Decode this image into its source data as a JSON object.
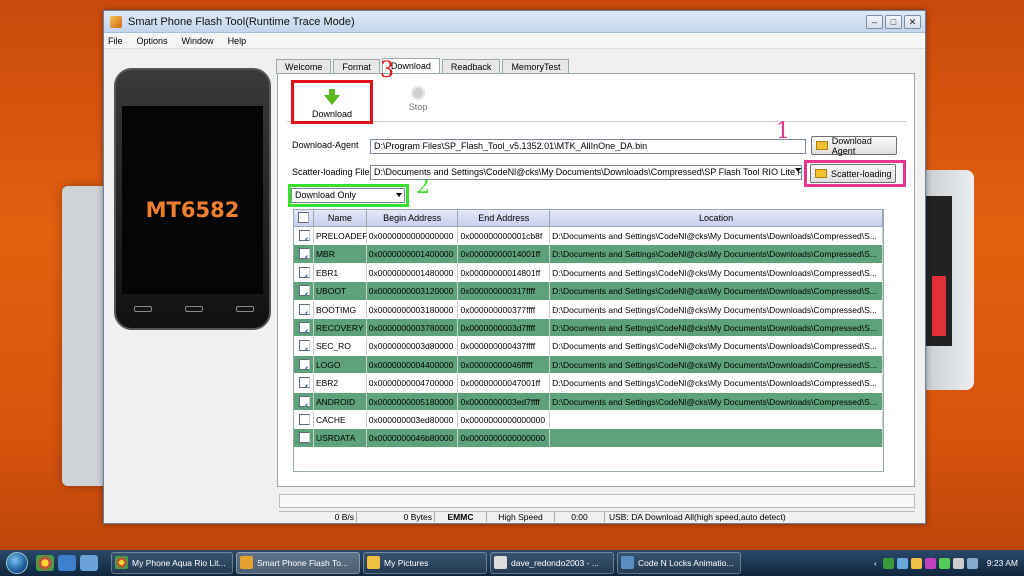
{
  "window": {
    "title": "Smart Phone Flash Tool(Runtime Trace Mode)",
    "menu": [
      "File",
      "Options",
      "Window",
      "Help"
    ]
  },
  "phone": {
    "label": "MT6582"
  },
  "tabs": [
    "Welcome",
    "Format",
    "Download",
    "Readback",
    "MemoryTest"
  ],
  "toolbar": {
    "download_label": "Download",
    "stop_label": "Stop"
  },
  "annotations": {
    "n1": "1",
    "n2": "2",
    "n3": "3"
  },
  "form": {
    "agent_label": "Download-Agent",
    "agent_value": "D:\\Program Files\\SP_Flash_Tool_v5.1352.01\\MTK_AllInOne_DA.bin",
    "agent_button": "Download Agent",
    "scatter_label": "Scatter-loading File",
    "scatter_value": "D:\\Documents and Settings\\CodeNl@cks\\My Documents\\Downloads\\Compressed\\SP Flash Tool RIO Lite Firmw",
    "scatter_button": "Scatter-loading",
    "mode_value": "Download Only"
  },
  "table": {
    "headers": [
      "",
      "Name",
      "Begin Address",
      "End Address",
      "Location"
    ],
    "rows": [
      {
        "checked": true,
        "name": "PRELOADER",
        "begin": "0x0000000000000000",
        "end": "0x000000000001cb8f",
        "location": "D:\\Documents and Settings\\CodeNl@cks\\My Documents\\Downloads\\Compressed\\S..."
      },
      {
        "checked": true,
        "name": "MBR",
        "begin": "0x0000000001400000",
        "end": "0x00000000014001ff",
        "location": "D:\\Documents and Settings\\CodeNl@cks\\My Documents\\Downloads\\Compressed\\S..."
      },
      {
        "checked": true,
        "name": "EBR1",
        "begin": "0x0000000001480000",
        "end": "0x00000000014801ff",
        "location": "D:\\Documents and Settings\\CodeNl@cks\\My Documents\\Downloads\\Compressed\\S..."
      },
      {
        "checked": true,
        "name": "UBOOT",
        "begin": "0x0000000003120000",
        "end": "0x000000000317ffff",
        "location": "D:\\Documents and Settings\\CodeNl@cks\\My Documents\\Downloads\\Compressed\\S..."
      },
      {
        "checked": true,
        "name": "BOOTIMG",
        "begin": "0x0000000003180000",
        "end": "0x000000000377ffff",
        "location": "D:\\Documents and Settings\\CodeNl@cks\\My Documents\\Downloads\\Compressed\\S..."
      },
      {
        "checked": true,
        "name": "RECOVERY",
        "begin": "0x0000000003780000",
        "end": "0x0000000003d7ffff",
        "location": "D:\\Documents and Settings\\CodeNl@cks\\My Documents\\Downloads\\Compressed\\S..."
      },
      {
        "checked": true,
        "name": "SEC_RO",
        "begin": "0x0000000003d80000",
        "end": "0x000000000437ffff",
        "location": "D:\\Documents and Settings\\CodeNl@cks\\My Documents\\Downloads\\Compressed\\S..."
      },
      {
        "checked": true,
        "name": "LOGO",
        "begin": "0x0000000004400000",
        "end": "0x00000000046fffff",
        "location": "D:\\Documents and Settings\\CodeNl@cks\\My Documents\\Downloads\\Compressed\\S..."
      },
      {
        "checked": true,
        "name": "EBR2",
        "begin": "0x0000000004700000",
        "end": "0x00000000047001ff",
        "location": "D:\\Documents and Settings\\CodeNl@cks\\My Documents\\Downloads\\Compressed\\S..."
      },
      {
        "checked": true,
        "name": "ANDROID",
        "begin": "0x0000000005180000",
        "end": "0x0000000003ed7ffff",
        "location": "D:\\Documents and Settings\\CodeNl@cks\\My Documents\\Downloads\\Compressed\\S..."
      },
      {
        "checked": false,
        "name": "CACHE",
        "begin": "0x000000003ed80000",
        "end": "0x0000000000000000",
        "location": ""
      },
      {
        "checked": false,
        "name": "USRDATA",
        "begin": "0x0000000046b80000",
        "end": "0x0000000000000000",
        "location": ""
      }
    ]
  },
  "status": {
    "speed": "0 B/s",
    "bytes": "0 Bytes",
    "storage": "EMMC",
    "usb_speed": "High Speed",
    "time": "0:00",
    "message": "USB: DA Download All(high speed,auto detect)"
  },
  "taskbar": {
    "tasks": [
      {
        "label": "My Phone Aqua Rio Lit...",
        "active": false
      },
      {
        "label": "Smart Phone Flash To...",
        "active": true
      },
      {
        "label": "My Pictures",
        "active": false
      },
      {
        "label": "dave_redondo2003 - ...",
        "active": false
      },
      {
        "label": "Code N Locks Animatio...",
        "active": false
      }
    ],
    "clock": "9:23 AM"
  },
  "colors": {
    "row_highlight": "#5ea27b",
    "download_box": "#e3131b",
    "mode_box": "#37e12b",
    "scatter_box": "#e8348e"
  }
}
